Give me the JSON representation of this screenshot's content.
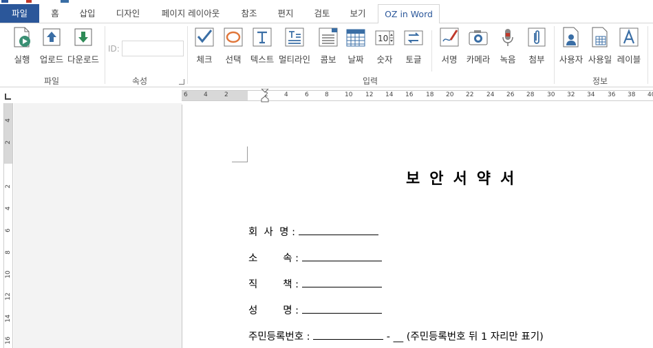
{
  "tabs": [
    {
      "label": "파일"
    },
    {
      "label": "홈"
    },
    {
      "label": "삽입"
    },
    {
      "label": "디자인"
    },
    {
      "label": "페이지 레이아웃"
    },
    {
      "label": "참조"
    },
    {
      "label": "편지"
    },
    {
      "label": "검토"
    },
    {
      "label": "보기"
    },
    {
      "label": "OZ in Word"
    }
  ],
  "ribbon": {
    "file_group": {
      "label": "파일",
      "buttons": [
        "실행",
        "업로드",
        "다운로드"
      ]
    },
    "attr_group": {
      "label": "속성",
      "id_label": "ID:",
      "id_value": ""
    },
    "input_group": {
      "label": "입력",
      "buttons": [
        "체크",
        "선택",
        "텍스트",
        "멀티라인",
        "콤보",
        "날짜",
        "숫자",
        "토글",
        "서명",
        "카메라",
        "녹음",
        "첨부"
      ]
    },
    "info_group": {
      "label": "정보",
      "buttons": [
        "사용자",
        "사용일",
        "레이블"
      ]
    },
    "numeric_icon_text": "10"
  },
  "ruler": {
    "h_ticks": [
      "6",
      "4",
      "2",
      "2",
      "4",
      "6",
      "8",
      "10",
      "12",
      "14",
      "16",
      "18",
      "20",
      "22",
      "24",
      "26",
      "28",
      "30",
      "32",
      "34",
      "36",
      "38",
      "40"
    ],
    "v_ticks": [
      "4",
      "2",
      "2",
      "4",
      "6",
      "8",
      "10",
      "12",
      "14",
      "16"
    ]
  },
  "document": {
    "title": "보안서약서",
    "fields": [
      {
        "label": "회  사  명 :",
        "after": ""
      },
      {
        "label": "소        속 :",
        "after": ""
      },
      {
        "label": "직        책 :",
        "after": ""
      },
      {
        "label": "성        명 :",
        "after": ""
      },
      {
        "label": "주민등록번호 :",
        "after": "- __ (주민등록번호 뒤 1 자리만 표기)"
      }
    ]
  },
  "colors": {
    "file_tab": "#2b579a",
    "icon_blue": "#3a6ea5",
    "icon_green": "#2e8b57",
    "icon_red": "#c0392b",
    "icon_orange": "#e0763a"
  }
}
